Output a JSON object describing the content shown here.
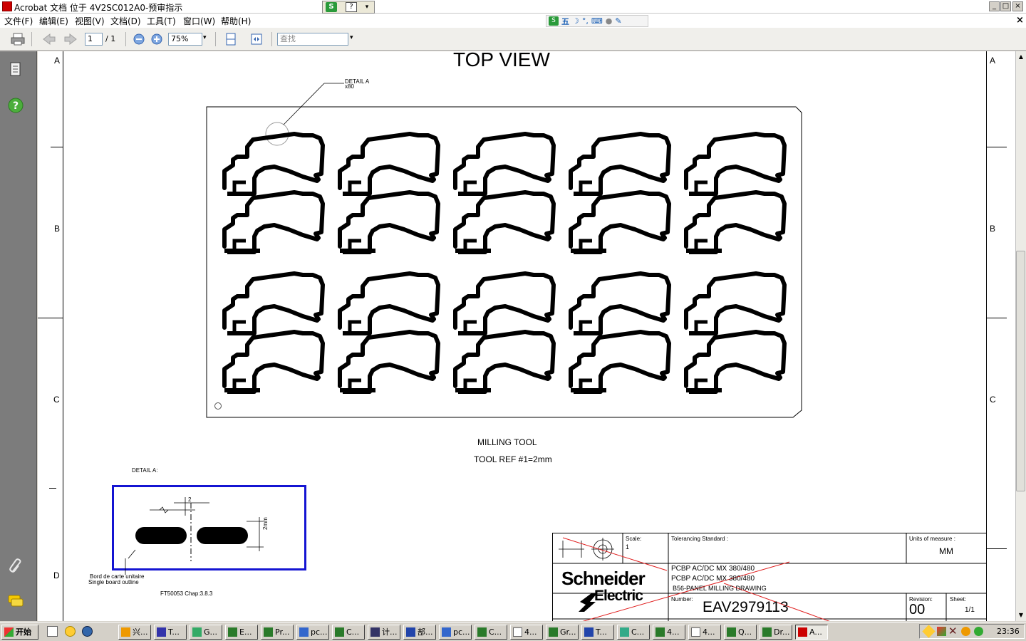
{
  "window": {
    "title": "Acrobat 文档 位于 4V2SC012A0-预审指示",
    "controls": [
      "_",
      "□",
      "×"
    ]
  },
  "menu": [
    {
      "label": "文件(F)"
    },
    {
      "label": "编辑(E)"
    },
    {
      "label": "视图(V)"
    },
    {
      "label": "文档(D)"
    },
    {
      "label": "工具(T)"
    },
    {
      "label": "窗口(W)"
    },
    {
      "label": "帮助(H)"
    }
  ],
  "ime_bar": {
    "mode_label": "五"
  },
  "toolbar": {
    "page_current": "1",
    "page_total": "/ 1",
    "zoom": "75%",
    "search_placeholder": "查找"
  },
  "drawing": {
    "view_title": "TOP VIEW",
    "detail_callout_line1": "DETAIL A",
    "detail_callout_line2": "x80",
    "border_labels_left": [
      "A",
      "B",
      "C",
      "D"
    ],
    "border_labels_right": [
      "A",
      "B",
      "C"
    ],
    "milling_tool_title": "MILLING TOOL",
    "milling_tool_ref": "TOOL REF #1=2mm",
    "detail_label": "DETAIL A:",
    "detail_dim_top": "2",
    "detail_dim_side": "2mm",
    "board_note_fr": "Bord de carte unitaire",
    "board_note_en": "Single board outline",
    "ref_note": "FT50053 Chap:3.8.3"
  },
  "title_block": {
    "scale_label": "Scale:",
    "scale_value": "1",
    "tolerancing_label": "Tolerancing Standard :",
    "units_label": "Units of measure :",
    "units_value": "MM",
    "company_line1": "Schneider",
    "company_line2": "Electric",
    "desc_line1": "PCBP AC/DC MX 380/480",
    "desc_line2": "PCBP AC/DC MX 380/480",
    "desc_line3": "B56-PANEL MILLING DRAWING",
    "number_label": "Number:",
    "number_value": "EAV2979113",
    "revision_label": "Revision:",
    "revision_value": "00",
    "sheet_label": "Sheet:",
    "sheet_value": "1/1"
  },
  "taskbar": {
    "start_label": "开始",
    "tasks": [
      {
        "label": "兴..."
      },
      {
        "label": "T..."
      },
      {
        "label": "G..."
      },
      {
        "label": "E..."
      },
      {
        "label": "Pr..."
      },
      {
        "label": "pc..."
      },
      {
        "label": "C..."
      },
      {
        "label": "计..."
      },
      {
        "label": "部..."
      },
      {
        "label": "pc..."
      },
      {
        "label": "C..."
      },
      {
        "label": "4..."
      },
      {
        "label": "Gr..."
      },
      {
        "label": "T..."
      },
      {
        "label": "C..."
      },
      {
        "label": "4..."
      },
      {
        "label": "4..."
      },
      {
        "label": "Q..."
      },
      {
        "label": "Dr..."
      },
      {
        "label": "A..."
      }
    ],
    "clock": "23:36"
  }
}
